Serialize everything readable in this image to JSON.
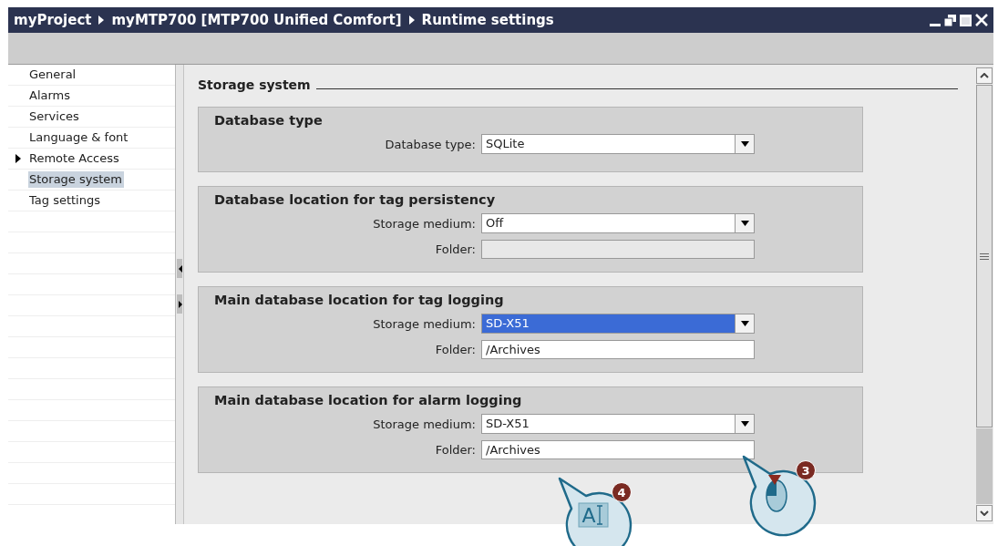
{
  "window": {
    "breadcrumb": [
      "myProject",
      "myMTP700 [MTP700 Unified Comfort]",
      "Runtime settings"
    ]
  },
  "sidebar": {
    "items": [
      {
        "label": "General",
        "selected": false,
        "expandable": false
      },
      {
        "label": "Alarms",
        "selected": false,
        "expandable": false
      },
      {
        "label": "Services",
        "selected": false,
        "expandable": false
      },
      {
        "label": "Language & font",
        "selected": false,
        "expandable": false
      },
      {
        "label": "Remote Access",
        "selected": false,
        "expandable": true
      },
      {
        "label": "Storage system",
        "selected": true,
        "expandable": false
      },
      {
        "label": "Tag settings",
        "selected": false,
        "expandable": false
      }
    ]
  },
  "section_title": "Storage system",
  "groups": [
    {
      "title": "Database type",
      "fields": [
        {
          "kind": "dropdown",
          "label": "Database type:",
          "value": "SQLite",
          "highlighted": false
        }
      ]
    },
    {
      "title": "Database location for tag persistency",
      "fields": [
        {
          "kind": "dropdown",
          "label": "Storage medium:",
          "value": "Off",
          "highlighted": false
        },
        {
          "kind": "text",
          "label": "Folder:",
          "disabled": true
        }
      ]
    },
    {
      "title": "Main database location for tag logging",
      "fields": [
        {
          "kind": "dropdown",
          "label": "Storage medium:",
          "value": "SD-X51",
          "highlighted": true
        },
        {
          "kind": "text",
          "label": "Folder:",
          "value": "/Archives",
          "disabled": false
        }
      ]
    },
    {
      "title": "Main database location for alarm logging",
      "fields": [
        {
          "kind": "dropdown",
          "label": "Storage medium:",
          "value": "SD-X51",
          "highlighted": false
        },
        {
          "kind": "text",
          "label": "Folder:",
          "value": "/Archives",
          "disabled": false
        }
      ]
    }
  ],
  "callouts": [
    {
      "number": "3",
      "kind": "mouse-click"
    },
    {
      "number": "4",
      "kind": "text-input",
      "glyph": "A"
    }
  ]
}
